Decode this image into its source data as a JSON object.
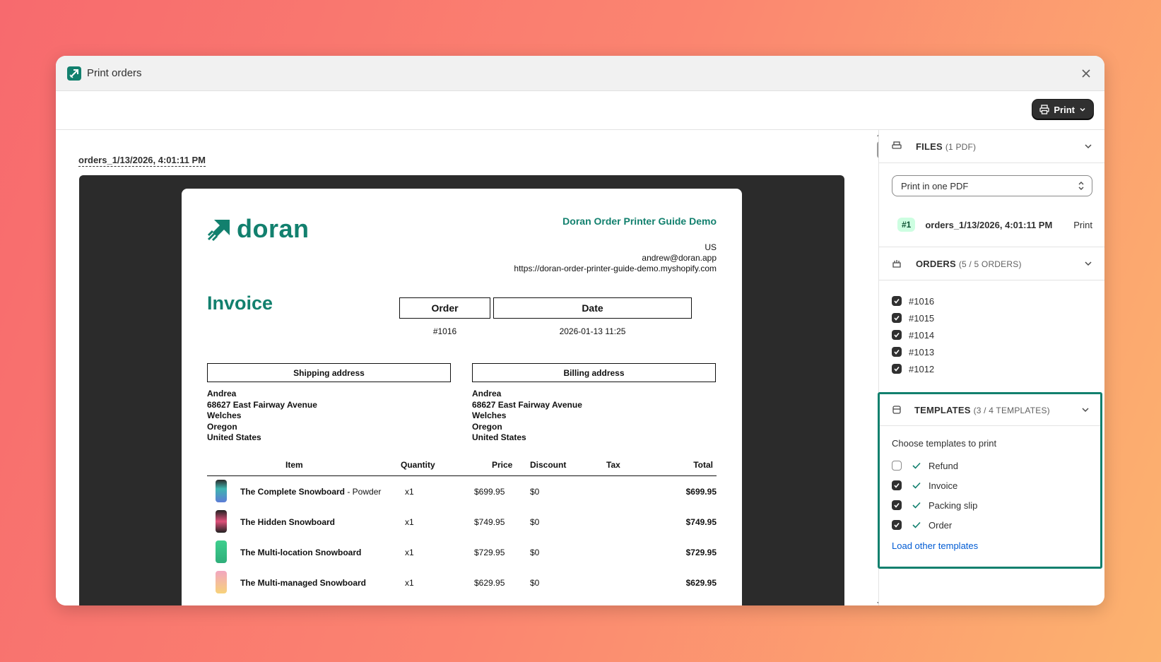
{
  "window": {
    "title": "Print orders",
    "print_label": "Print"
  },
  "preview": {
    "file_label": "orders_1/13/2026, 4:01:11 PM"
  },
  "invoice": {
    "logo_text": "doran",
    "store_name": "Doran Order Printer Guide Demo",
    "store_country": "US",
    "store_email": "andrew@doran.app",
    "store_url": "https://doran-order-printer-guide-demo.myshopify.com",
    "title": "Invoice",
    "order_header": "Order",
    "date_header": "Date",
    "order_number": "#1016",
    "order_date": "2026-01-13 11:25",
    "shipping_header": "Shipping address",
    "billing_header": "Billing address",
    "shipping": [
      "Andrea",
      "68627 East Fairway Avenue",
      "Welches",
      "Oregon",
      "United States"
    ],
    "billing": [
      "Andrea",
      "68627 East Fairway Avenue",
      "Welches",
      "Oregon",
      "United States"
    ],
    "columns": {
      "item": "Item",
      "quantity": "Quantity",
      "price": "Price",
      "discount": "Discount",
      "tax": "Tax",
      "total": "Total"
    },
    "items": [
      {
        "name": "The Complete Snowboard",
        "variant": " - Powder",
        "qty": "x1",
        "price": "$699.95",
        "discount": "$0",
        "total": "$699.95",
        "color": "#3fb5b0"
      },
      {
        "name": "The Hidden Snowboard",
        "variant": "",
        "qty": "x1",
        "price": "$749.95",
        "discount": "$0",
        "total": "$749.95",
        "color": "#e0507a"
      },
      {
        "name": "The Multi-location Snowboard",
        "variant": "",
        "qty": "x1",
        "price": "$729.95",
        "discount": "$0",
        "total": "$729.95",
        "color": "#3ecf8e"
      },
      {
        "name": "The Multi-managed Snowboard",
        "variant": "",
        "qty": "x1",
        "price": "$629.95",
        "discount": "$0",
        "total": "$629.95",
        "color": "#f2a6c0"
      }
    ]
  },
  "sidebar": {
    "files": {
      "title": "FILES",
      "count": "(1 PDF)",
      "select_value": "Print in one PDF",
      "file_number": "#1",
      "file_name": "orders_1/13/2026, 4:01:11 PM",
      "file_action": "Print"
    },
    "orders": {
      "title": "ORDERS",
      "count": "(5 / 5 ORDERS)",
      "items": [
        {
          "label": "#1016",
          "checked": true
        },
        {
          "label": "#1015",
          "checked": true
        },
        {
          "label": "#1014",
          "checked": true
        },
        {
          "label": "#1013",
          "checked": true
        },
        {
          "label": "#1012",
          "checked": true
        }
      ]
    },
    "templates": {
      "title": "TEMPLATES",
      "count": "(3 / 4 TEMPLATES)",
      "subtitle": "Choose templates to print",
      "items": [
        {
          "label": "Refund",
          "checked": false
        },
        {
          "label": "Invoice",
          "checked": true
        },
        {
          "label": "Packing slip",
          "checked": true
        },
        {
          "label": "Order",
          "checked": true
        }
      ],
      "load_link": "Load other templates"
    }
  },
  "colors": {
    "brand": "#12806e",
    "highlight_border": "#12806e",
    "link": "#005bd3"
  }
}
